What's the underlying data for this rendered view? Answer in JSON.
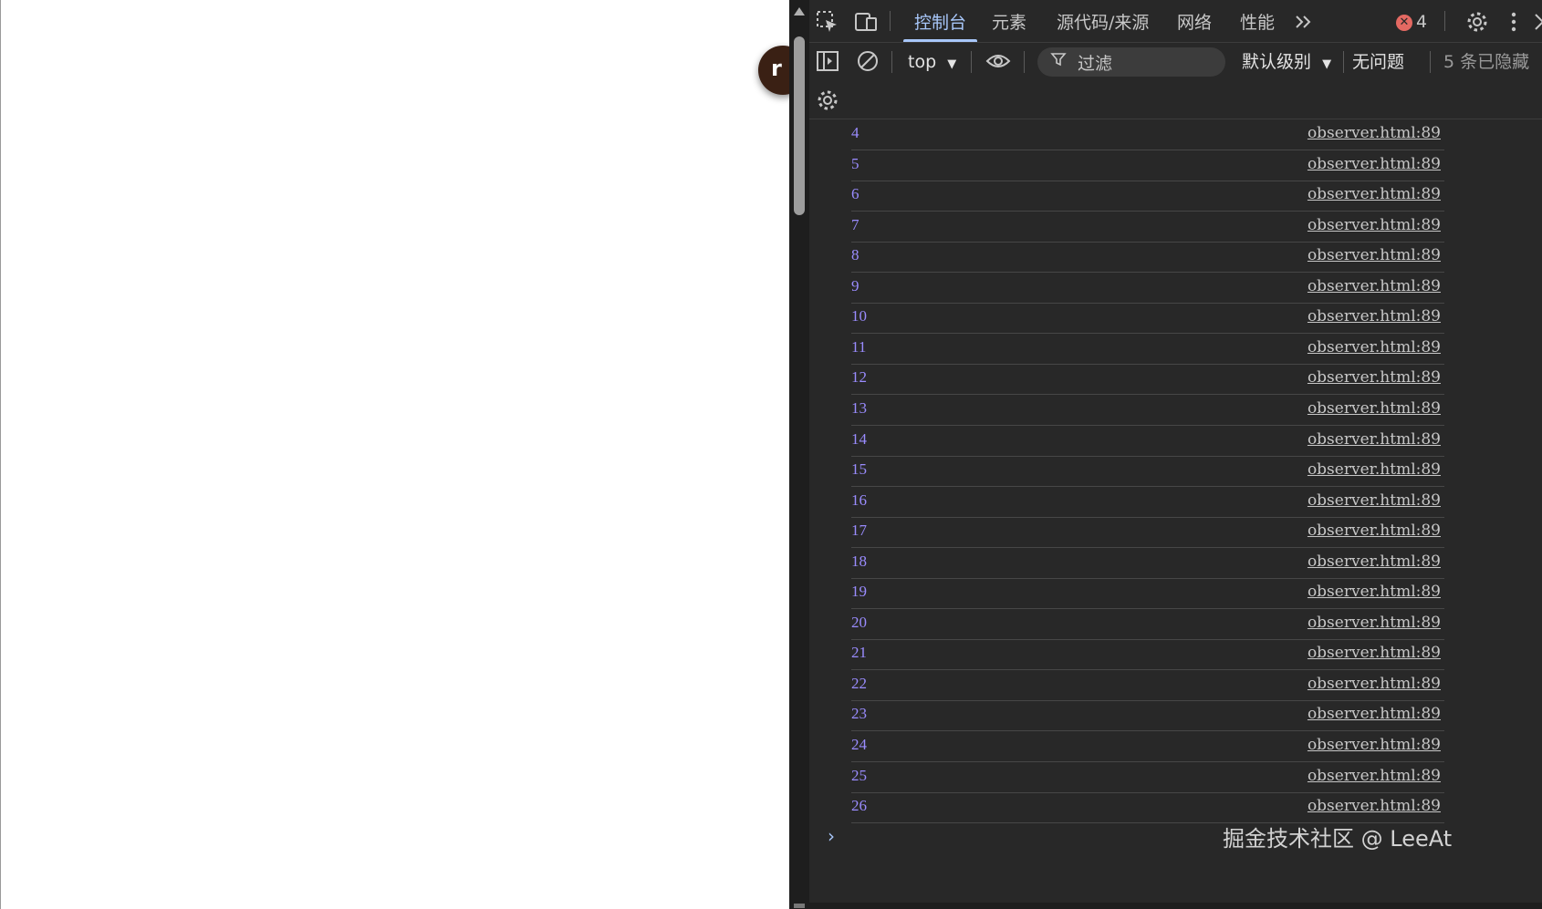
{
  "page": {
    "avatar_letter": "r"
  },
  "devtools": {
    "tabs": [
      {
        "label": "控制台",
        "active": true
      },
      {
        "label": "元素",
        "active": false
      },
      {
        "label": "源代码/来源",
        "active": false
      },
      {
        "label": "网络",
        "active": false
      },
      {
        "label": "性能",
        "active": false
      }
    ],
    "more_tabs_icon": "chevron-double-right-icon",
    "error_count": "4",
    "icons": {
      "inspect": "inspect-element-icon",
      "device": "device-toolbar-icon",
      "settings": "gear-icon",
      "menu": "kebab-menu-icon",
      "close": "close-icon"
    }
  },
  "toolbar": {
    "context": "top",
    "filter_placeholder": "过滤",
    "levels": "默认级别",
    "issues": "无问题",
    "hidden": "5 条已隐藏"
  },
  "console": {
    "entries": [
      {
        "value": "4",
        "source": "observer.html:89"
      },
      {
        "value": "5",
        "source": "observer.html:89"
      },
      {
        "value": "6",
        "source": "observer.html:89"
      },
      {
        "value": "7",
        "source": "observer.html:89"
      },
      {
        "value": "8",
        "source": "observer.html:89"
      },
      {
        "value": "9",
        "source": "observer.html:89"
      },
      {
        "value": "10",
        "source": "observer.html:89"
      },
      {
        "value": "11",
        "source": "observer.html:89"
      },
      {
        "value": "12",
        "source": "observer.html:89"
      },
      {
        "value": "13",
        "source": "observer.html:89"
      },
      {
        "value": "14",
        "source": "observer.html:89"
      },
      {
        "value": "15",
        "source": "observer.html:89"
      },
      {
        "value": "16",
        "source": "observer.html:89"
      },
      {
        "value": "17",
        "source": "observer.html:89"
      },
      {
        "value": "18",
        "source": "observer.html:89"
      },
      {
        "value": "19",
        "source": "observer.html:89"
      },
      {
        "value": "20",
        "source": "observer.html:89"
      },
      {
        "value": "21",
        "source": "observer.html:89"
      },
      {
        "value": "22",
        "source": "observer.html:89"
      },
      {
        "value": "23",
        "source": "observer.html:89"
      },
      {
        "value": "24",
        "source": "observer.html:89"
      },
      {
        "value": "25",
        "source": "observer.html:89"
      },
      {
        "value": "26",
        "source": "observer.html:89"
      }
    ],
    "prompt": "›"
  },
  "watermark": "掘金技术社区 @ LeeAt",
  "colors": {
    "panel_bg": "#282828",
    "active_tab": "#a8c7fa",
    "log_number": "#9a8cff",
    "error_badge": "#e46962"
  }
}
